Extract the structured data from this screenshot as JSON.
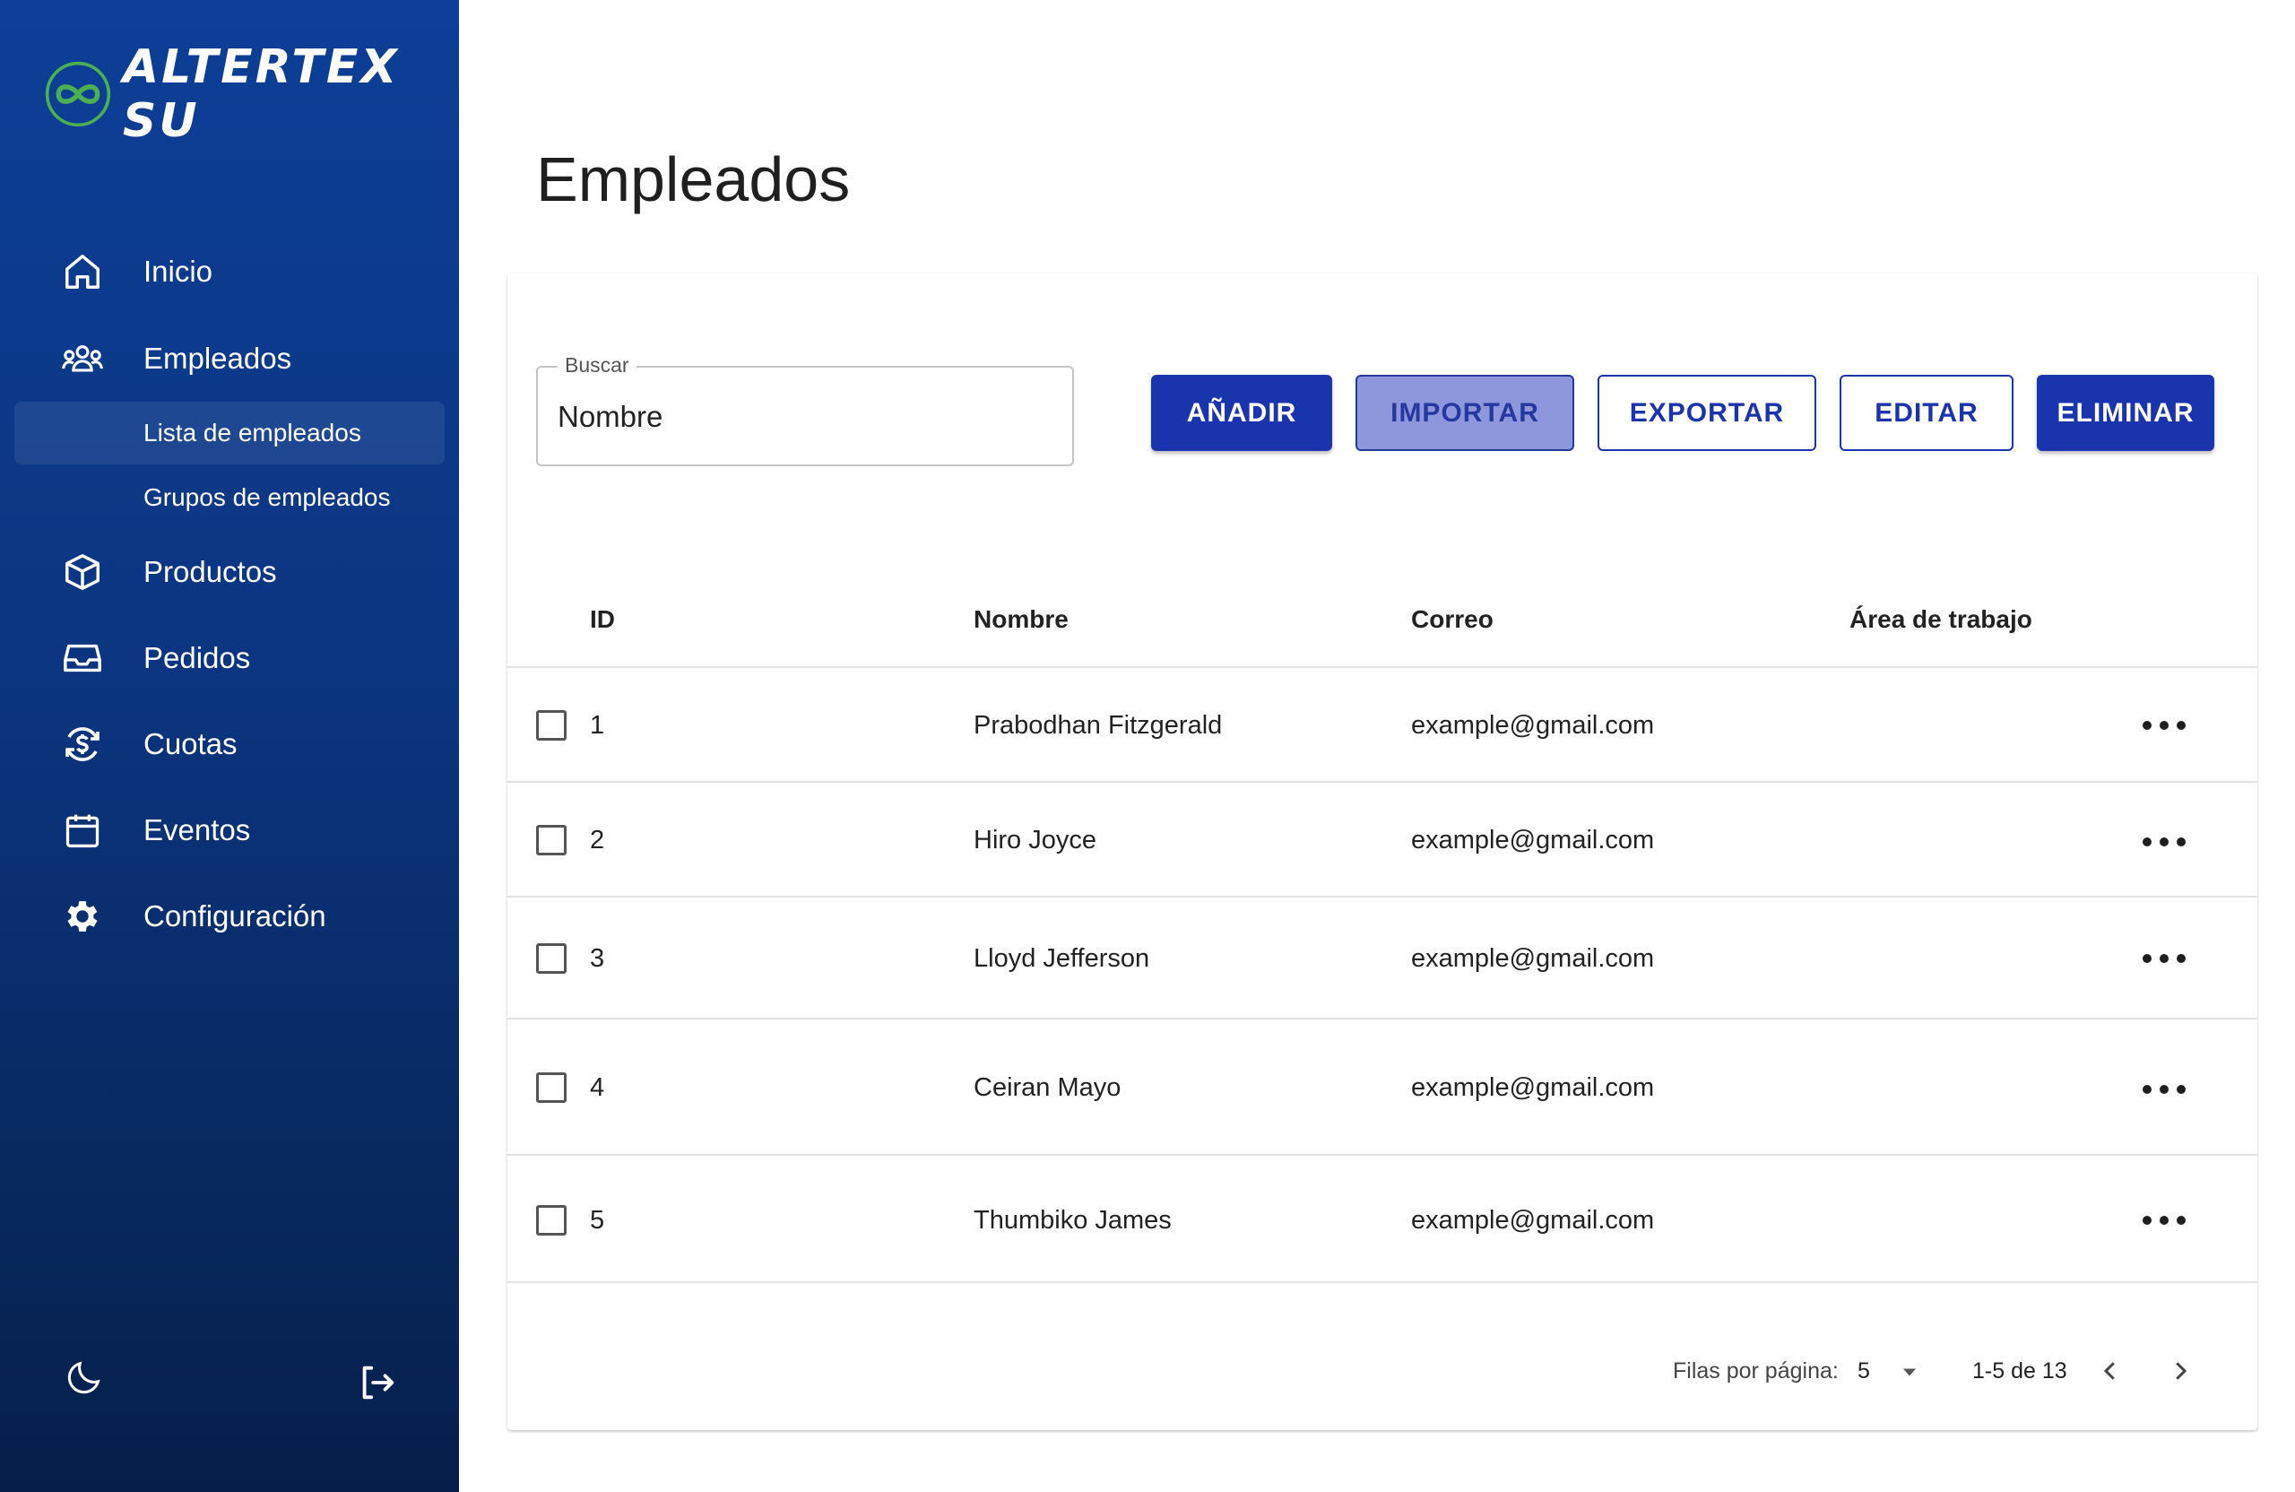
{
  "brand": {
    "name": "ALTERTEX SU",
    "accent": "#4caf50"
  },
  "sidebar": {
    "items": [
      {
        "label": "Inicio",
        "icon": "home-icon"
      },
      {
        "label": "Empleados",
        "icon": "users-icon"
      },
      {
        "label": "Lista de empleados",
        "active": true
      },
      {
        "label": "Grupos de empleados"
      },
      {
        "label": "Productos",
        "icon": "box-icon"
      },
      {
        "label": "Pedidos",
        "icon": "inbox-icon"
      },
      {
        "label": "Cuotas",
        "icon": "currency-refresh-icon"
      },
      {
        "label": "Eventos",
        "icon": "calendar-icon"
      },
      {
        "label": "Configuración",
        "icon": "gear-icon"
      }
    ],
    "bottom": {
      "theme_icon": "moon-icon",
      "logout_icon": "logout-icon"
    }
  },
  "page": {
    "title": "Empleados"
  },
  "search": {
    "legend": "Buscar",
    "value": "Nombre"
  },
  "toolbar": {
    "add": "AÑADIR",
    "import": "IMPORTAR",
    "export": "EXPORTAR",
    "edit": "EDITAR",
    "delete": "ELIMINAR"
  },
  "table": {
    "columns": [
      "ID",
      "Nombre",
      "Correo",
      "Área de trabajo"
    ],
    "rows": [
      {
        "id": "1",
        "name": "Prabodhan Fitzgerald",
        "email": "example@gmail.com",
        "area": ""
      },
      {
        "id": "2",
        "name": "Hiro Joyce",
        "email": "example@gmail.com",
        "area": ""
      },
      {
        "id": "3",
        "name": "Lloyd Jefferson",
        "email": "example@gmail.com",
        "area": ""
      },
      {
        "id": "4",
        "name": "Ceiran Mayo",
        "email": "example@gmail.com",
        "area": ""
      },
      {
        "id": "5",
        "name": "Thumbiko James",
        "email": "example@gmail.com",
        "area": ""
      }
    ]
  },
  "pagination": {
    "rows_label": "Filas por página:",
    "rows_value": "5",
    "range": "1-5 de 13"
  },
  "colors": {
    "primary": "#1a34ad",
    "sidebar_top": "#0d3f98",
    "sidebar_bottom": "#061f4a"
  }
}
